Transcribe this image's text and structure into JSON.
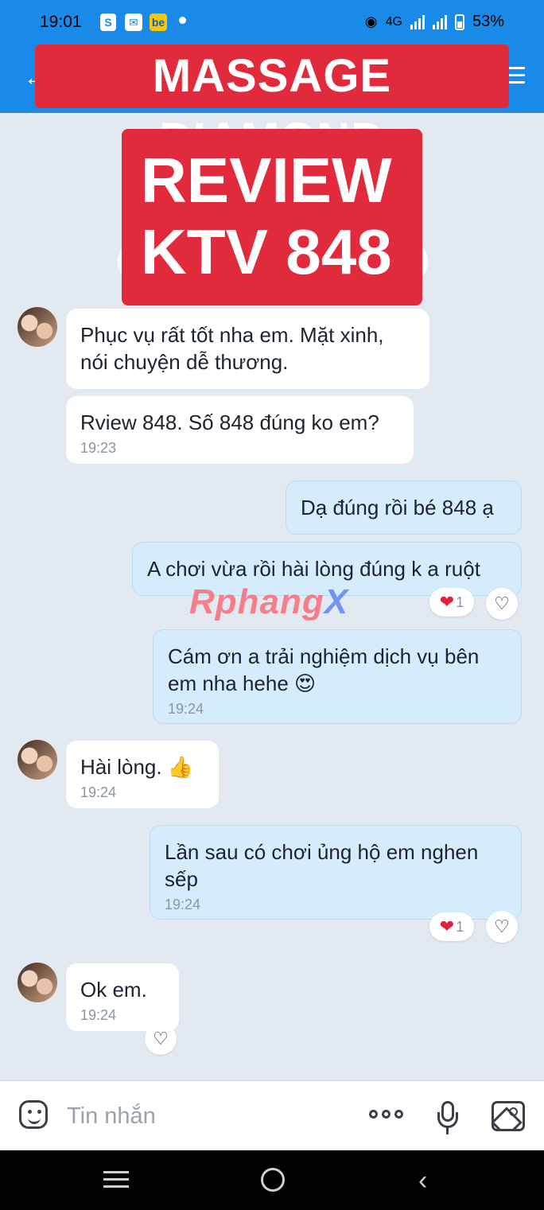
{
  "status_bar": {
    "time": "19:01",
    "network": "4G",
    "battery": "53%"
  },
  "header": {
    "title": "MASSAGE DIAMOND"
  },
  "review_banner": {
    "line1": "REVIEW",
    "line2": "KTV 848"
  },
  "watermark": {
    "text_a": "Rphang",
    "text_b": "X"
  },
  "messages": [
    {
      "from": "other",
      "text": "Phục vụ rất tốt nha em. Mặt xinh, nói chuyện dễ thương.",
      "time": ""
    },
    {
      "from": "other",
      "text": "Rview 848. Số 848 đúng ko em?",
      "time": "19:23"
    },
    {
      "from": "me",
      "text": "Dạ đúng rồi bé 848 ạ",
      "time": ""
    },
    {
      "from": "me",
      "text": "A chơi vừa rồi hài lòng đúng k a ruột",
      "time": "",
      "reaction": "❤",
      "reaction_count": "1"
    },
    {
      "from": "me",
      "text": "Cám ơn a trải nghiệm dịch vụ bên em nha hehe 😍",
      "time": "19:24"
    },
    {
      "from": "other",
      "text": "Hài lòng. 👍",
      "time": "19:24"
    },
    {
      "from": "me",
      "text": "Lần sau có chơi ủng hộ em nghen sếp",
      "time": "19:24",
      "reaction": "❤",
      "reaction_count": "1"
    },
    {
      "from": "other",
      "text": "Ok em.",
      "time": "19:24"
    }
  ],
  "input": {
    "placeholder": "Tin nhắn"
  },
  "icons": {
    "like": "♡",
    "back": "‹"
  }
}
